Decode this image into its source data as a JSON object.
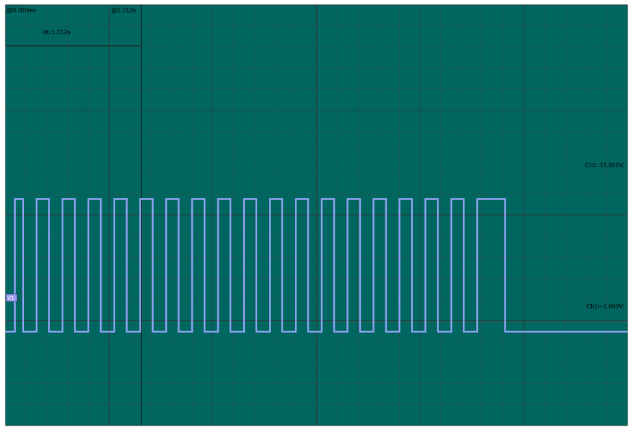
{
  "colors": {
    "background": "#006660",
    "grid": "#1f5a55",
    "grid_major": "#2b3f3c",
    "trace": "#8fa3f2",
    "cursor": "#1a1a1a",
    "marker_fill": "#9a9cf0"
  },
  "cursors": {
    "left_time": "@0.000ms",
    "right_time": "@1.012s",
    "delta": "dt=1.012s",
    "ch1_high": "Ch1=15.041V;",
    "ch1_low": "Ch1=-1.680V;"
  },
  "channel_marker": "V1",
  "chart_data": {
    "type": "line",
    "title": "",
    "xlabel": "",
    "ylabel": "",
    "xlim": [
      -0.3,
      5.7
    ],
    "ylim": [
      -13.5,
      39.5
    ],
    "grid": true,
    "series": [
      {
        "name": "",
        "step": true,
        "x": [
          -0.3,
          -0.21,
          -0.21,
          -0.13,
          -0.13,
          0.0,
          0.0,
          0.12,
          0.12,
          0.25,
          0.25,
          0.37,
          0.37,
          0.5,
          0.5,
          0.62,
          0.62,
          0.75,
          0.75,
          0.87,
          0.87,
          1.0,
          1.0,
          1.12,
          1.12,
          1.25,
          1.25,
          1.37,
          1.37,
          1.5,
          1.5,
          1.62,
          1.62,
          1.75,
          1.75,
          1.87,
          1.87,
          2.0,
          2.0,
          2.12,
          2.12,
          2.25,
          2.25,
          2.37,
          2.37,
          2.5,
          2.5,
          2.62,
          2.62,
          2.75,
          2.75,
          2.87,
          2.87,
          3.0,
          3.0,
          3.12,
          3.12,
          3.25,
          3.25,
          3.37,
          3.37,
          3.5,
          3.5,
          3.62,
          3.62,
          3.75,
          3.75,
          3.87,
          3.87,
          4.0,
          4.0,
          4.12,
          4.12,
          4.25,
          4.25,
          4.52,
          4.52,
          5.7
        ],
        "y": [
          -1.68,
          -1.68,
          15.04,
          15.04,
          -1.68,
          -1.68,
          15.04,
          15.04,
          -1.68,
          -1.68,
          15.04,
          15.04,
          -1.68,
          -1.68,
          15.04,
          15.04,
          -1.68,
          -1.68,
          15.04,
          15.04,
          -1.68,
          -1.68,
          15.04,
          15.04,
          -1.68,
          -1.68,
          15.04,
          15.04,
          -1.68,
          -1.68,
          15.04,
          15.04,
          -1.68,
          -1.68,
          15.04,
          15.04,
          -1.68,
          -1.68,
          15.04,
          15.04,
          -1.68,
          -1.68,
          15.04,
          15.04,
          -1.68,
          -1.68,
          15.04,
          15.04,
          -1.68,
          -1.68,
          15.04,
          15.04,
          -1.68,
          -1.68,
          15.04,
          15.04,
          -1.68,
          -1.68,
          15.04,
          15.04,
          -1.68,
          -1.68,
          15.04,
          15.04,
          -1.68,
          -1.68,
          15.04,
          15.04,
          -1.68,
          -1.68,
          15.04,
          15.04,
          -1.68,
          -1.68,
          15.04,
          15.04,
          -1.68,
          -1.68
        ]
      }
    ]
  }
}
